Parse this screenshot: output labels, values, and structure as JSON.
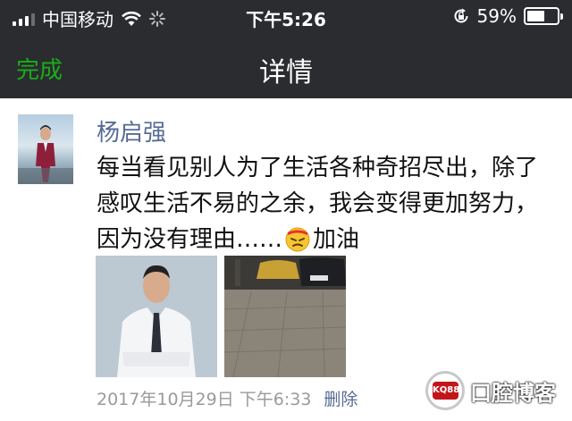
{
  "status_bar": {
    "carrier": "中国移动",
    "time": "下午5:26",
    "battery_percent": "59%",
    "battery_level": 0.59,
    "icons": [
      "signal-icon",
      "wifi-icon",
      "loading-icon",
      "rotation-lock-icon",
      "battery-icon"
    ]
  },
  "nav": {
    "done_label": "完成",
    "title": "详情"
  },
  "post": {
    "author": "杨启强",
    "text_before_emoji": "每当看见别人为了生活各种奇招尽出，除了感叹生活不易的之余，我会变得更加努力，因为没有理由……",
    "emoji": "fighting-emoji",
    "text_after_emoji": "加油",
    "photos": [
      "portrait-photo",
      "street-night-photo"
    ],
    "date": "2017年10月29日 下午6:33",
    "delete_label": "删除"
  },
  "watermark": {
    "badge": "KQ88",
    "text": "口腔博客"
  },
  "colors": {
    "nav_bg": "#2a2c2f",
    "done_green": "#1aad19",
    "link_blue": "#576b95",
    "meta_gray": "#9a9a9a"
  }
}
